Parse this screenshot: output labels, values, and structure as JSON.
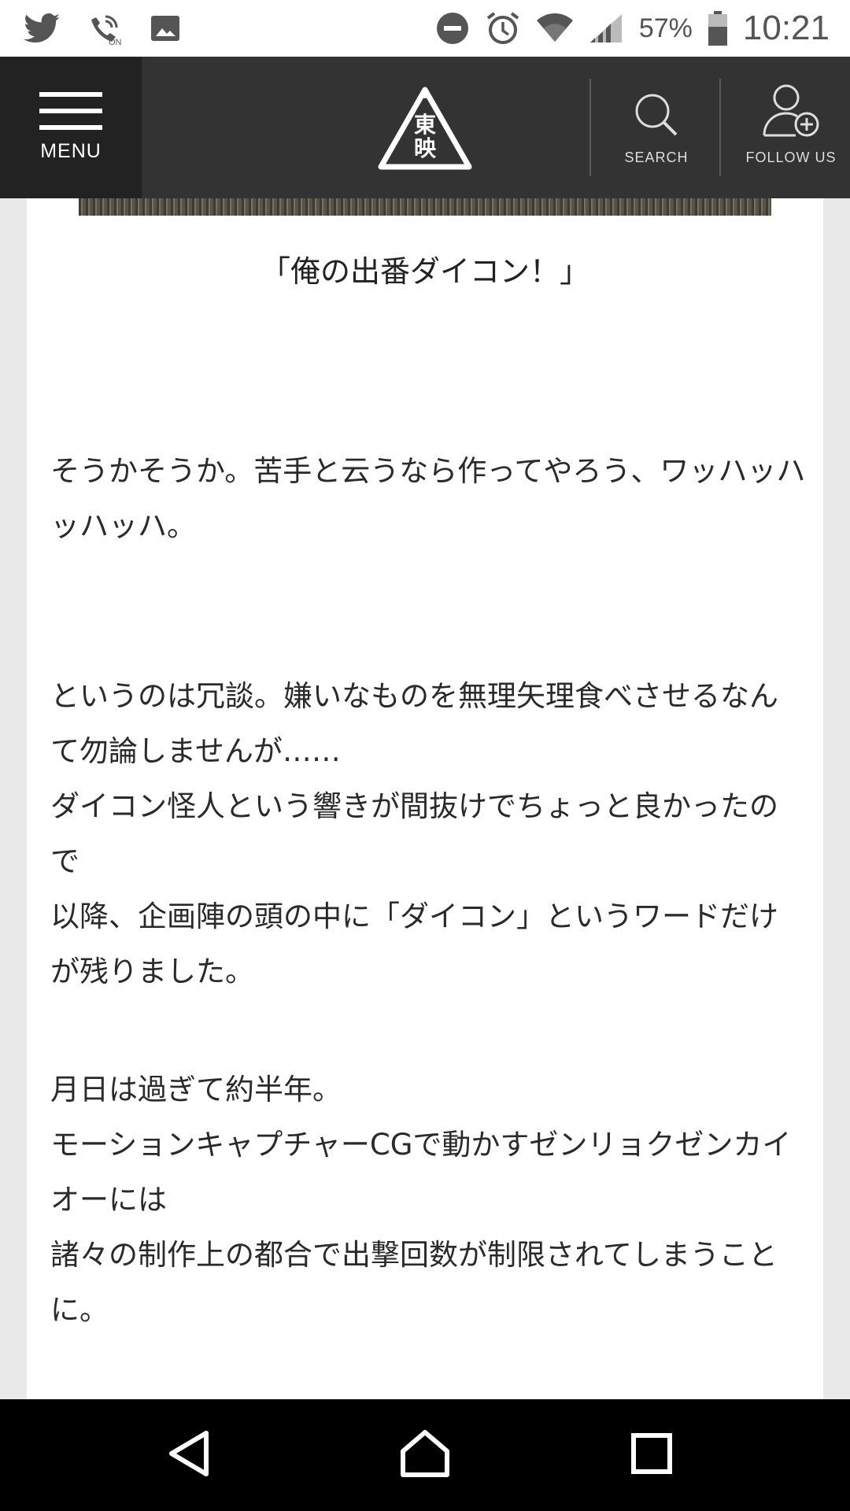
{
  "status_bar": {
    "battery_percent": "57%",
    "time": "10:21",
    "left_icons": [
      "twitter-icon",
      "wifi-calling-icon",
      "image-icon"
    ],
    "right_icons": [
      "do-not-disturb-icon",
      "alarm-icon",
      "wifi-icon",
      "signal-icon",
      "battery-icon"
    ],
    "wifi_calling_badge": "ON"
  },
  "header": {
    "menu_label": "MENU",
    "logo_text": [
      "東",
      "映"
    ],
    "search_label": "SEARCH",
    "follow_label": "FOLLOW US"
  },
  "article": {
    "caption": "「俺の出番ダイコン！」",
    "paragraphs": [
      "そうかそうか。苦手と云うなら作ってやろう、ワッハッハッハッハ。",
      "というのは冗談。嫌いなものを無理矢理食べさせるなんて勿論しませんが……",
      "ダイコン怪人という響きが間抜けでちょっと良かったので",
      "以降、企画陣の頭の中に「ダイコン」というワードだけが残りました。",
      "月日は過ぎて約半年。",
      "モーションキャプチャーCGで動かすゼンリョクゼンカイオーには",
      "諸々の制作上の都合で出撃回数が制限されてしまうことに。"
    ]
  },
  "nav_bar": {
    "icons": [
      "back-icon",
      "home-icon",
      "recents-icon"
    ]
  },
  "colors": {
    "header_bg": "#333333",
    "menu_bg": "#222222",
    "page_bg": "#e9e9e9",
    "card_bg": "#ffffff"
  }
}
